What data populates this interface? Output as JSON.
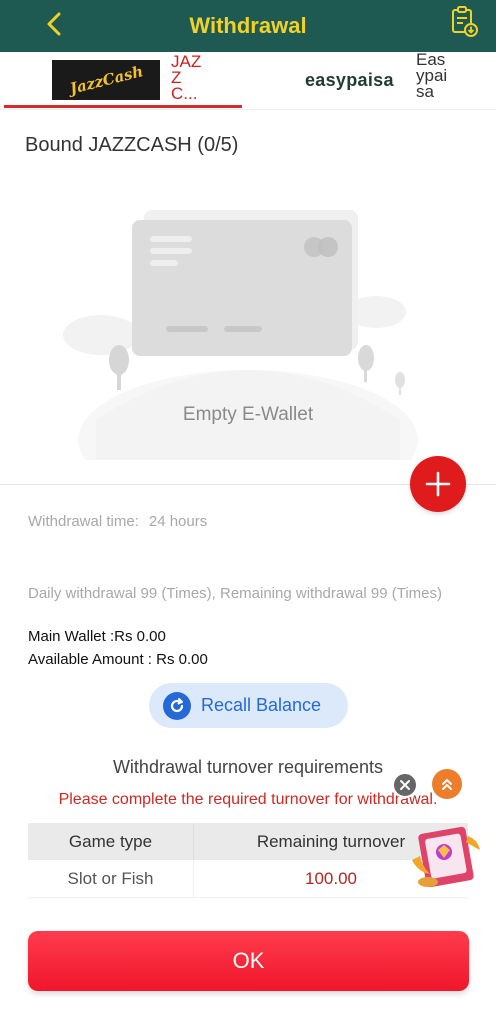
{
  "header": {
    "title": "Withdrawal"
  },
  "tabs": {
    "jazz_logo_text": "JazzCash",
    "jazz_label": "JAZZC...",
    "easy_logo_text": "easypaisa",
    "easy_label": "Easypaisa"
  },
  "bound_label": "Bound JAZZCASH (0/5)",
  "empty_label": "Empty E-Wallet",
  "withdrawal_time": {
    "label": "Withdrawal time:",
    "value": "24 hours"
  },
  "daily_text": "Daily withdrawal 99 (Times), Remaining withdrawal 99 (Times)",
  "main_wallet": "Main Wallet :Rs 0.00",
  "available_amount": "Available Amount : Rs 0.00",
  "recall_label": "Recall Balance",
  "turnover": {
    "title": "Withdrawal turnover requirements",
    "warning": "Please complete the required turnover for withdrawal.",
    "headers": [
      "Game type",
      "Remaining turnover"
    ],
    "rows": [
      [
        "Slot or Fish",
        "100.00"
      ]
    ]
  },
  "ok_label": "OK",
  "colors": {
    "header_bg": "#1e5a52",
    "title": "#f0d12a",
    "accent_red": "#e01b1b",
    "recall_blue": "#2569d9"
  }
}
